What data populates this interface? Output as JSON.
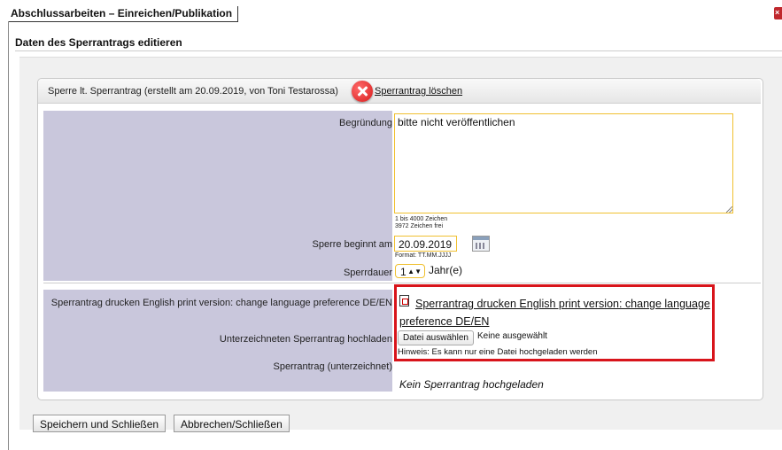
{
  "page": {
    "title": "Abschlussarbeiten – Einreichen/Publikation",
    "subtitle": "Daten des Sperrantrags editieren",
    "close_glyph": "×"
  },
  "panel": {
    "header_text": "Sperre lt. Sperrantrag (erstellt am 20.09.2019, von Toni Testarossa)",
    "delete_link": "Sperrantrag löschen"
  },
  "form": {
    "reason_label": "Begründung",
    "reason_value": "bitte nicht veröffentlichen",
    "char_range": "1 bis 4000 Zeichen",
    "chars_free": "3972 Zeichen frei",
    "start_label": "Sperre beginnt am",
    "start_value": "20.09.2019",
    "date_format": "Format: TT.MM.JJJJ",
    "duration_label": "Sperrdauer",
    "duration_value": "1",
    "duration_unit": "Jahr(e)"
  },
  "documents": {
    "print_label": "Sperrantrag drucken English print version: change language preference DE/EN",
    "print_link": "Sperrantrag drucken English print version: change language preference DE/EN",
    "upload_label": "Unterzeichneten Sperrantrag hochladen",
    "file_button": "Datei auswählen",
    "no_file": "Keine ausgewählt",
    "upload_hint": "Hinweis: Es kann nur eine Datei hochgeladen werden",
    "signed_label": "Sperrantrag (unterzeichnet)",
    "signed_value": "Kein Sperrantrag hochgeladen"
  },
  "buttons": {
    "save": "Speichern und Schließen",
    "cancel": "Abbrechen/Schließen"
  },
  "colors": {
    "label_bg": "#c9c7dc",
    "highlight_border": "#d8141b",
    "input_border": "#f0c030"
  }
}
